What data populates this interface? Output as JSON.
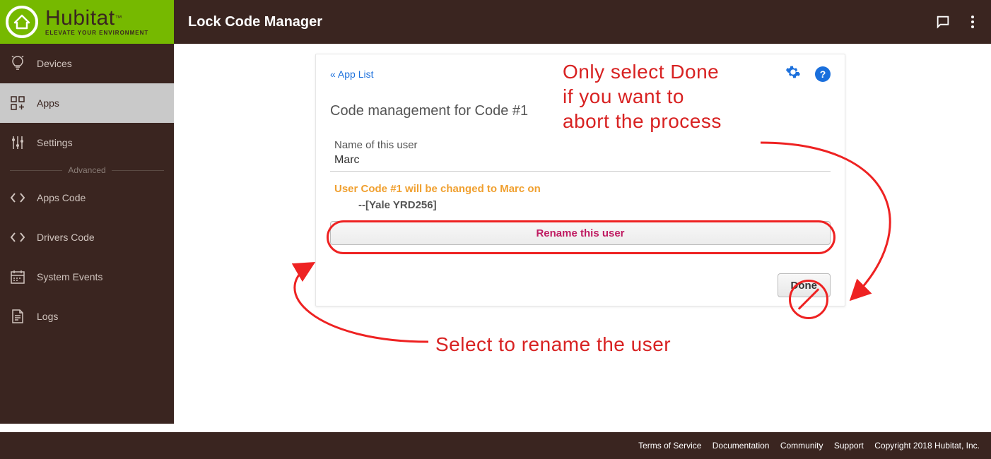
{
  "brand": {
    "name": "Hubitat",
    "tagline": "ELEVATE YOUR ENVIRONMENT",
    "tm": "™"
  },
  "header": {
    "title": "Lock Code Manager"
  },
  "sidebar": {
    "items": [
      {
        "label": "Devices"
      },
      {
        "label": "Apps"
      },
      {
        "label": "Settings"
      },
      {
        "label": "Apps Code"
      },
      {
        "label": "Drivers Code"
      },
      {
        "label": "System Events"
      },
      {
        "label": "Logs"
      }
    ],
    "advanced_label": "Advanced"
  },
  "panel": {
    "applist_link": "« App List",
    "heading": "Code management for Code #1",
    "field_label": "Name of this user",
    "field_value": "Marc",
    "status_text": "User Code #1 will be changed to Marc on",
    "lock_line": "--[Yale YRD256]",
    "rename_button": "Rename this user",
    "done_button": "Done"
  },
  "annotations": {
    "done_warning": "Only select Done\nif you want to\nabort the process",
    "rename_hint": "Select to rename the user"
  },
  "footer": {
    "links": [
      "Terms of Service",
      "Documentation",
      "Community",
      "Support"
    ],
    "copyright": "Copyright 2018 Hubitat, Inc."
  }
}
